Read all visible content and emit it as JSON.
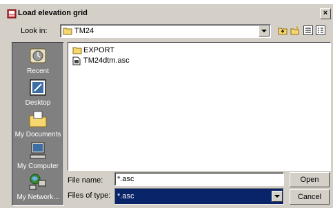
{
  "window": {
    "title": "Load elevation grid"
  },
  "lookin": {
    "label": "Look in:",
    "value": "TM24"
  },
  "places": [
    {
      "label": "Recent",
      "icon": "recent-icon"
    },
    {
      "label": "Desktop",
      "icon": "desktop-icon"
    },
    {
      "label": "My Documents",
      "icon": "my-documents-icon"
    },
    {
      "label": "My Computer",
      "icon": "my-computer-icon"
    },
    {
      "label": "My Network...",
      "icon": "my-network-icon"
    }
  ],
  "files": [
    {
      "name": "EXPORT",
      "icon": "folder-icon"
    },
    {
      "name": "TM24dtm.asc",
      "icon": "file-icon"
    }
  ],
  "filename": {
    "label": "File name:",
    "value": "*.asc"
  },
  "filetype": {
    "label": "Files of type:",
    "value": "*.asc"
  },
  "buttons": {
    "open": "Open",
    "cancel": "Cancel"
  },
  "colors": {
    "dialog_bg": "#d4d0c8",
    "selection": "#0a246a",
    "places_bg": "#808080"
  }
}
